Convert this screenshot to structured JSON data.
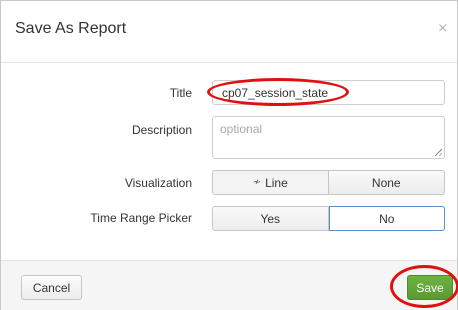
{
  "dialog": {
    "title": "Save As Report",
    "close_glyph": "×"
  },
  "form": {
    "title_label": "Title",
    "title_value": "cp07_session_state",
    "description_label": "Description",
    "description_placeholder": "optional",
    "visualization_label": "Visualization",
    "visualization_options": [
      "Line",
      "None"
    ],
    "visualization_line_glyph": "≁",
    "time_range_label": "Time Range Picker",
    "time_range_options": [
      "Yes",
      "No"
    ],
    "time_range_selected": "No"
  },
  "footer": {
    "cancel_label": "Cancel",
    "save_label": "Save"
  },
  "colors": {
    "save_green": "#5a9a32",
    "highlight_red": "#e01010",
    "selected_border": "#5b8fd0"
  }
}
